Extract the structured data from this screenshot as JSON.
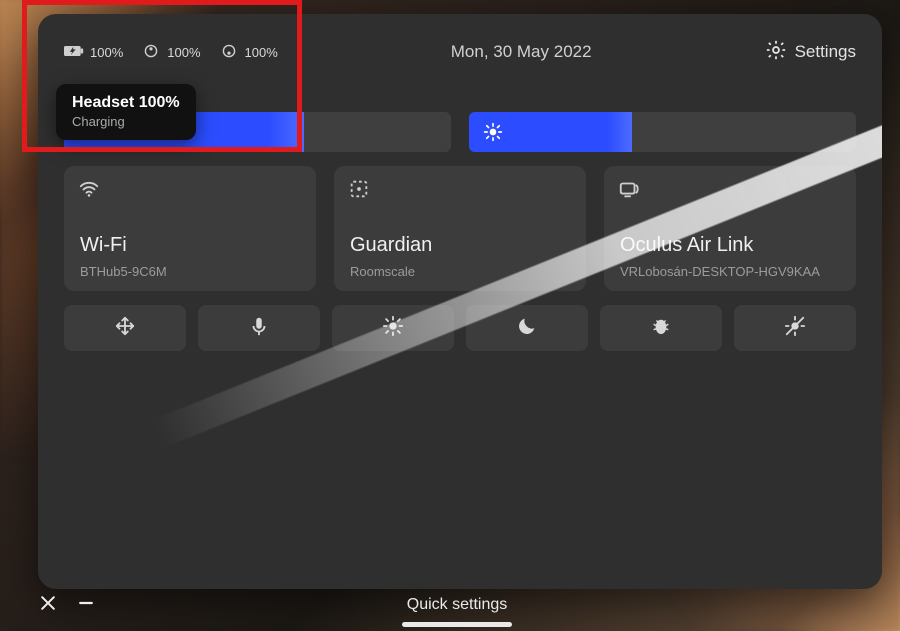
{
  "header": {
    "battery": {
      "headset_pct": "100%",
      "left_controller_pct": "100%",
      "right_controller_pct": "100%"
    },
    "date": "Mon, 30 May 2022",
    "settings_label": "Settings"
  },
  "tooltip": {
    "title": "Headset 100%",
    "subtitle": "Charging"
  },
  "sliders": {
    "volume_fill_pct": 62,
    "brightness_fill_pct": 42
  },
  "cards": {
    "wifi": {
      "title": "Wi-Fi",
      "subtitle": "BTHub5-9C6M"
    },
    "guardian": {
      "title": "Guardian",
      "subtitle": "Roomscale"
    },
    "airlink": {
      "title": "Oculus Air Link",
      "subtitle": "VRLobosán-DESKTOP-HGV9KAA"
    }
  },
  "quick_buttons": {
    "items": [
      "move",
      "mic",
      "brightness",
      "night",
      "bug",
      "record-off"
    ]
  },
  "dock": {
    "title": "Quick settings"
  },
  "annotation": {
    "red_box_label": "battery-status-highlight"
  }
}
